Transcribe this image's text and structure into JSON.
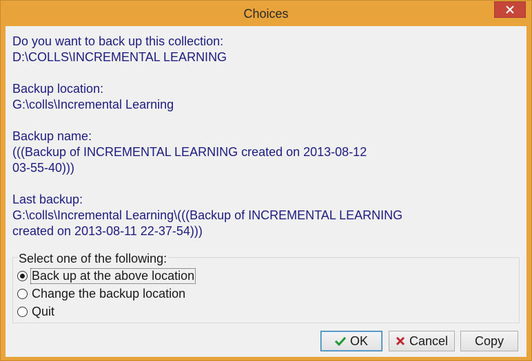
{
  "window": {
    "title": "Choices",
    "accent": "#e8a33b",
    "close_color": "#c7463a"
  },
  "message": {
    "question": "Do you want to back up this collection:",
    "collection_path": "D:\\COLLS\\INCREMENTAL LEARNING",
    "location_label": "Backup location:",
    "location_value": "G:\\colls\\Incremental Learning",
    "name_label": "Backup name:",
    "name_value_line1": "(((Backup of INCREMENTAL LEARNING created on 2013-08-12",
    "name_value_line2": "03-55-40)))",
    "last_label": "Last backup:",
    "last_value_line1": "G:\\colls\\Incremental Learning\\(((Backup of INCREMENTAL LEARNING",
    "last_value_line2": "created on 2013-08-11 22-37-54)))"
  },
  "options": {
    "legend": "Select one of the following:",
    "items": [
      {
        "label": "Back up at the above location",
        "selected": true
      },
      {
        "label": "Change the backup location",
        "selected": false
      },
      {
        "label": "Quit",
        "selected": false
      }
    ]
  },
  "buttons": {
    "ok": "OK",
    "cancel": "Cancel",
    "copy": "Copy"
  },
  "icons": {
    "ok": "check-icon",
    "cancel": "x-icon",
    "close": "close-icon"
  }
}
